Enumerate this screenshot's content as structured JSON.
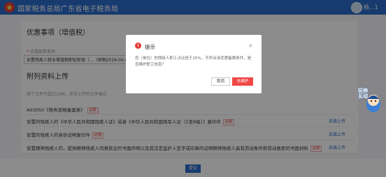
{
  "header": {
    "brand": "国家税务总局广东省电子税务局",
    "user_name": "杨...1"
  },
  "section_preferential": {
    "title": "优惠事项（增值税）",
    "field_label": "优惠政策事项",
    "field_value": "安置残疾人就业增值税即征即退（...（财税2016-05-01..."
  },
  "section_attach": {
    "title": "附列资料上传",
    "hint": "单个文件不超过10M，支持上传的文件格式",
    "rows": [
      {
        "name": "A03050《税务资格备案表》",
        "tag": "必报",
        "action": ""
      },
      {
        "name": "安置的残疾人的《中华人民共和国残疾人证》或者《中华人民共和国残军人证（1至8级）》复印件",
        "tag": "必报",
        "action": "去填上传"
      },
      {
        "name": "安置的残疾人的身份证明复印件",
        "tag": "必报",
        "action": "去填上传"
      },
      {
        "name": "安置精神残疾人的，提供精神残疾人同意就业的书面声明以及其法定监护人签字或印章的证明精神残疾人具有劳动条件和劳动意愿的书面材料",
        "tag": "必报",
        "action": "去填上传"
      }
    ]
  },
  "footer": {
    "submit_label": "提交"
  },
  "dialog": {
    "title": "提示",
    "message": "您（单位）的残疾人职工占比低于25%，不符合该优惠备案条件，是否维护职工信息？",
    "cancel_label": "取消",
    "confirm_label": "去维护",
    "close_symbol": "×"
  },
  "mascot": {
    "label_line1": "征纳",
    "label_line2": "互动"
  },
  "colors": {
    "primary": "#2a6cc8",
    "danger": "#f04848",
    "overlay": "rgba(0,0,0,0.45)"
  }
}
